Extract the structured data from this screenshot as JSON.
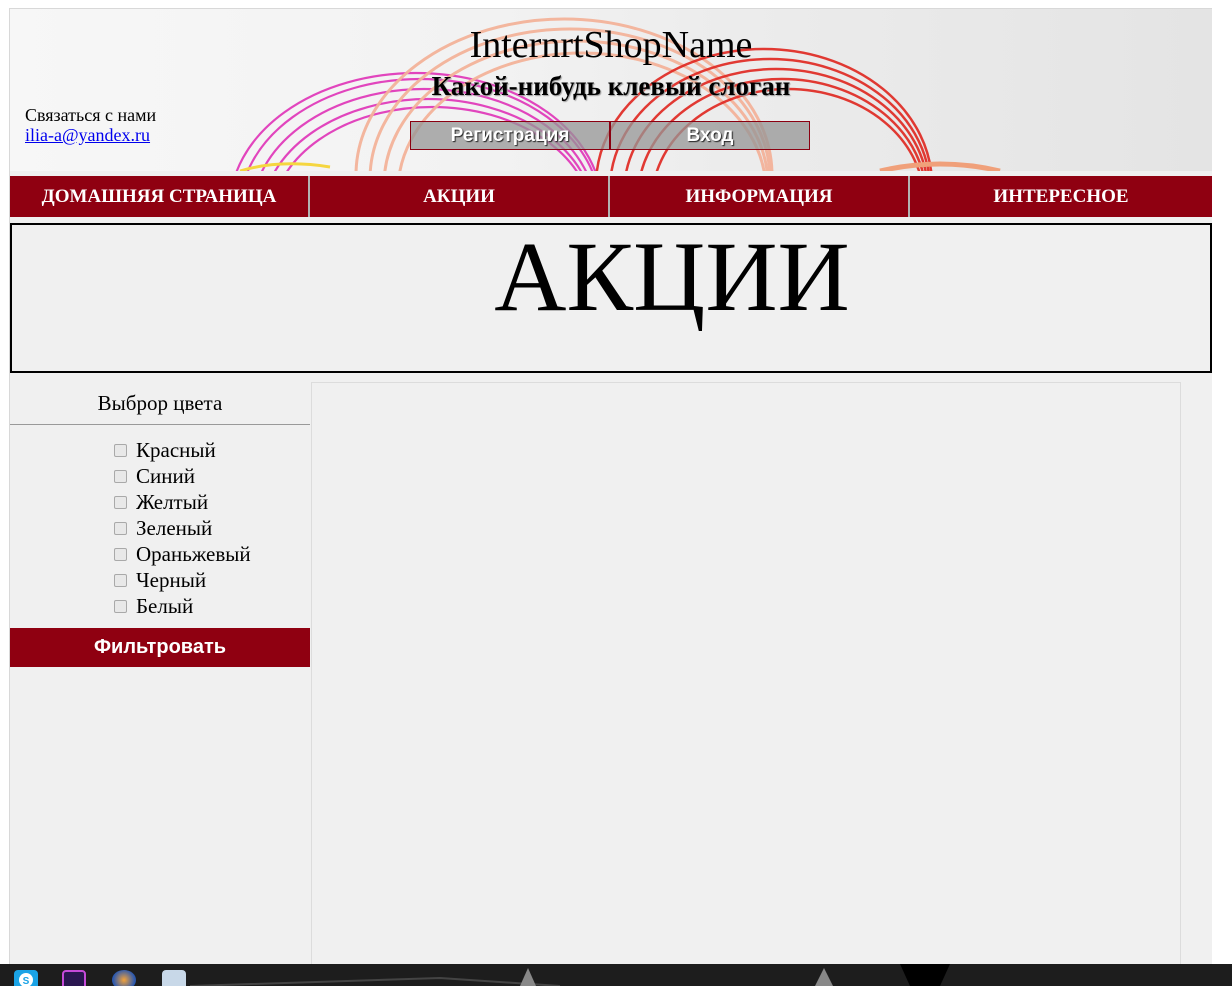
{
  "header": {
    "shop_name": "InternrtShopName",
    "slogan": "Какой-нибудь клевый слоган",
    "contact_label": "Связаться с нами",
    "contact_email": "ilia-a@yandex.ru",
    "register_label": "Регистрация",
    "login_label": "Вход"
  },
  "nav": {
    "items": [
      {
        "label": "ДОМАШНЯЯ СТРАНИЦА"
      },
      {
        "label": "АКЦИИ"
      },
      {
        "label": "ИНФОРМАЦИЯ"
      },
      {
        "label": "ИНТЕРЕСНОЕ"
      }
    ]
  },
  "banner": {
    "title": "АКЦИИ"
  },
  "sidebar": {
    "filter_title": "Выброр цвета",
    "colors": [
      "Красный",
      "Синий",
      "Желтый",
      "Зеленый",
      "Ораньжевый",
      "Черный",
      "Белый"
    ],
    "filter_button": "Фильтровать"
  },
  "taskbar": {
    "icons": [
      "skype-icon",
      "photoshop-icon",
      "eclipse-icon",
      "notepad-icon"
    ]
  },
  "colors": {
    "accent": "#8f0011",
    "link": "#0000ee",
    "page_bg": "#f0f0f0"
  }
}
